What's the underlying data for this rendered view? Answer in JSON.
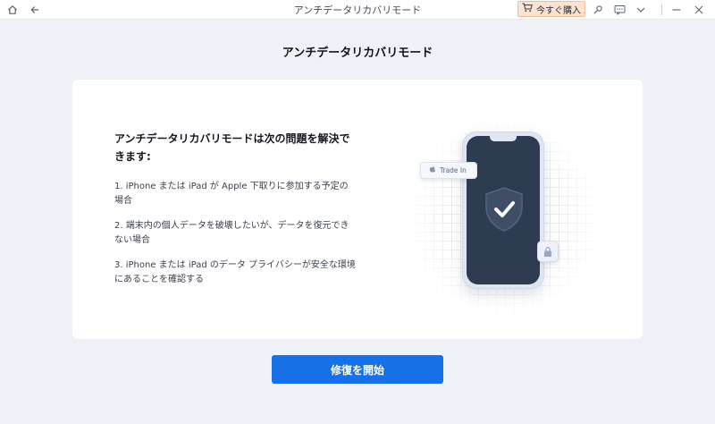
{
  "window": {
    "title": "アンチデータリカバリモード",
    "buy_label": "今すぐ購入"
  },
  "page": {
    "title": "アンチデータリカバリモード"
  },
  "card": {
    "heading": "アンチデータリカバリモードは次の問題を解決できます:",
    "items": [
      "1. iPhone または iPad が Apple 下取りに参加する予定の場合",
      "2. 端末内の個人データを破壊したいが、データを復元できない場合",
      "3. iPhone または iPad のデータ プライバシーが安全な環境にあることを確認する"
    ],
    "tradein_label": "Trade In"
  },
  "actions": {
    "start_label": "修復を開始"
  },
  "colors": {
    "accent": "#1771e6",
    "buy_bg": "#fde3d2",
    "phone_screen": "#2f3b50"
  },
  "icons": [
    "home-icon",
    "back-arrow-icon",
    "cart-icon",
    "key-icon",
    "feedback-icon",
    "chevron-down-icon",
    "minimize-icon",
    "close-icon",
    "apple-icon",
    "shield-check-icon",
    "lock-icon"
  ]
}
